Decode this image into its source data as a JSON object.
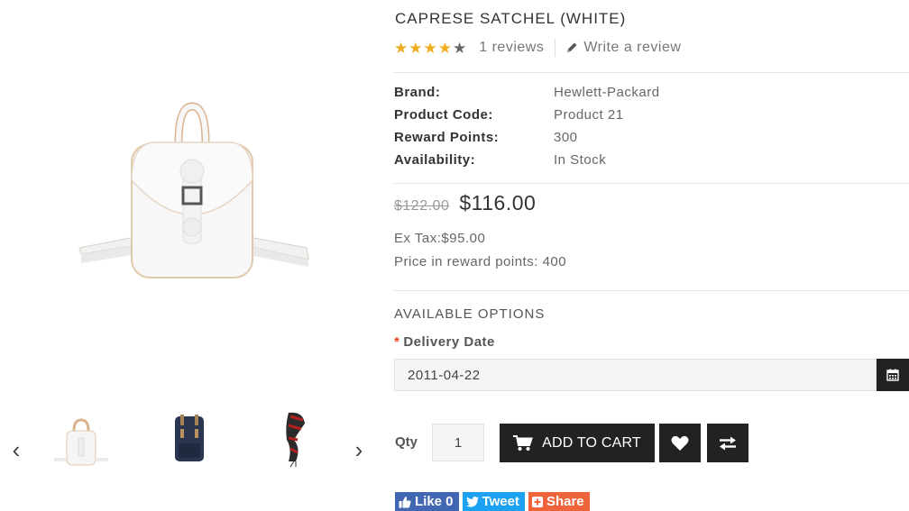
{
  "product": {
    "title": "CAPRESE SATCHEL (WHITE)",
    "rating": 4,
    "rating_max": 5,
    "reviews_text": "1 reviews",
    "write_review": "Write a review"
  },
  "info": [
    {
      "label": "Brand:",
      "value": "Hewlett-Packard"
    },
    {
      "label": "Product Code:",
      "value": "Product 21"
    },
    {
      "label": "Reward Points:",
      "value": "300"
    },
    {
      "label": "Availability:",
      "value": "In Stock"
    }
  ],
  "price": {
    "old": "$122.00",
    "new": "$116.00",
    "ex_tax": "Ex Tax:$95.00",
    "reward": "Price in reward points: 400"
  },
  "options": {
    "heading": "AVAILABLE OPTIONS",
    "required_mark": "*",
    "delivery_label": "Delivery Date",
    "delivery_value": "2011-04-22"
  },
  "purchase": {
    "qty_label": "Qty",
    "qty_value": "1",
    "add_to_cart": "ADD TO CART"
  },
  "social": {
    "like": "Like 0",
    "tweet": "Tweet",
    "share": "Share"
  },
  "thumbnails": [
    "white-satchel",
    "navy-backpack",
    "plaid-scarf"
  ],
  "colors": {
    "star": "#f0ad1f",
    "button": "#222222",
    "required": "#e3442f",
    "facebook": "#4267b2",
    "twitter": "#1da1f2",
    "share": "#f0643c"
  }
}
